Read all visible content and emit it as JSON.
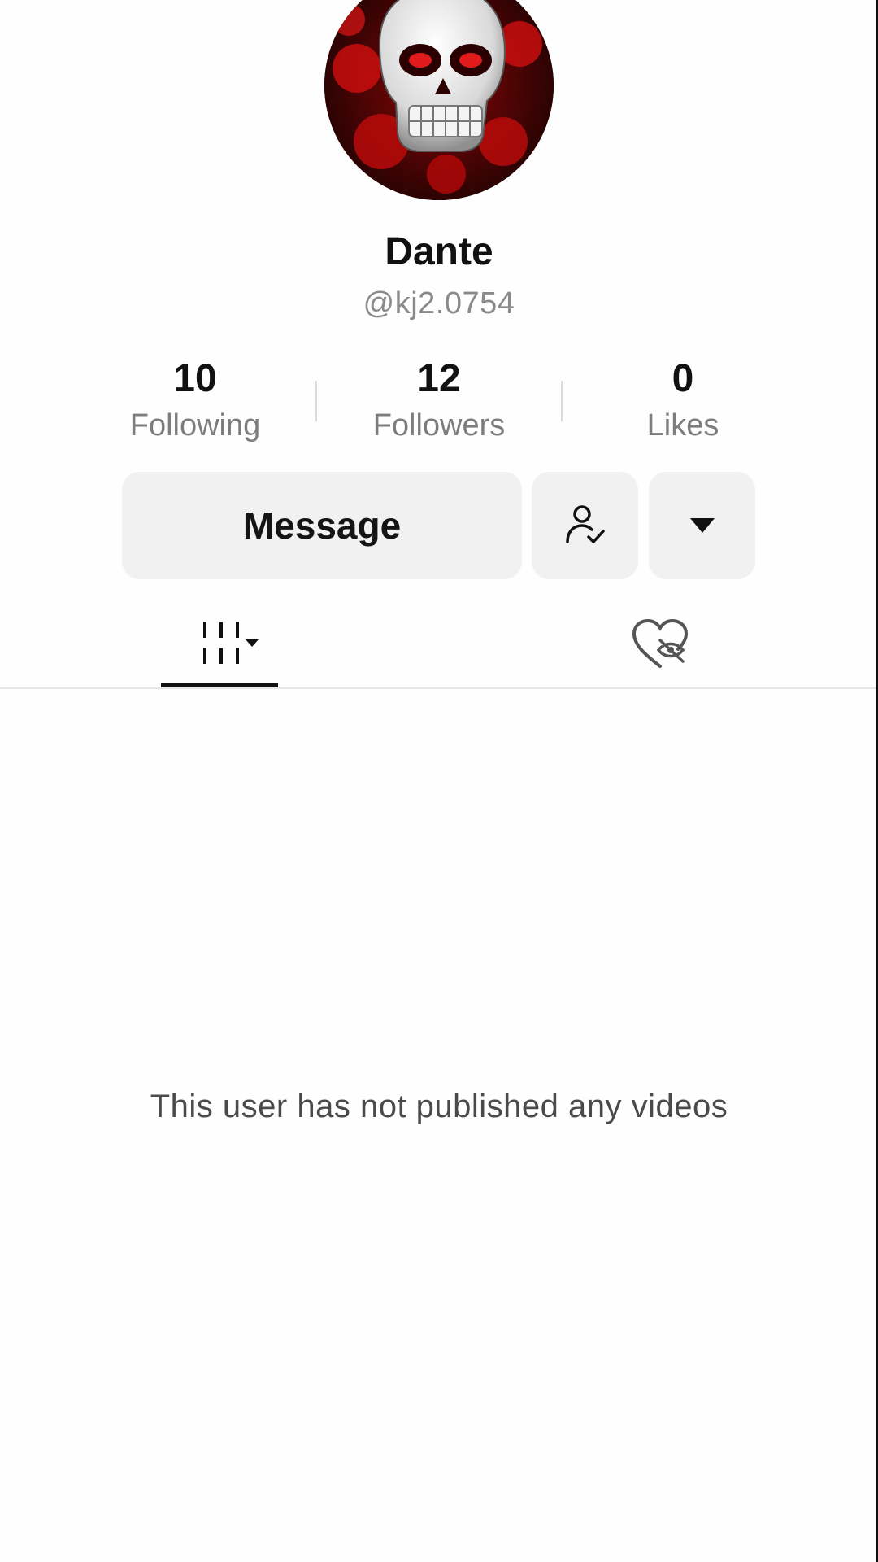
{
  "profile": {
    "display_name": "Dante",
    "handle": "@kj2.0754",
    "avatar_icon": "skull-avatar"
  },
  "stats": [
    {
      "value": "10",
      "label": "Following"
    },
    {
      "value": "12",
      "label": "Followers"
    },
    {
      "value": "0",
      "label": "Likes"
    }
  ],
  "actions": {
    "message_label": "Message",
    "follow_icon": "person-check-icon",
    "more_icon": "caret-down-icon"
  },
  "tabs": {
    "videos_icon": "grid-bars-icon",
    "liked_icon": "hidden-heart-icon",
    "active": "videos"
  },
  "content": {
    "empty_message": "This user has not published any videos"
  },
  "colors": {
    "text_primary": "#111111",
    "text_secondary": "#8a8a8a",
    "button_bg": "#f1f1f1",
    "avatar_red": "#c30f0f"
  }
}
